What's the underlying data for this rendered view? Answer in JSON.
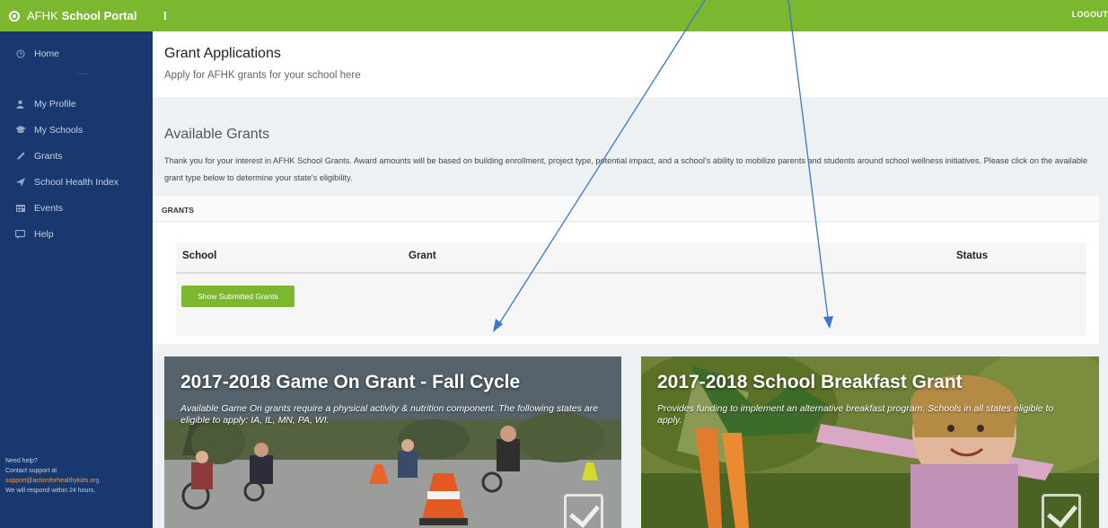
{
  "topbar": {
    "brand_prefix": "AFHK",
    "brand_name": "School Portal",
    "menu_toggle": "I",
    "logout_label": "LOGOUT",
    "accent_color": "#7cb82f"
  },
  "sidebar": {
    "background_color": "#1a3870",
    "items": [
      {
        "label": "Home",
        "icon": "clock-icon"
      },
      {
        "label": "My Profile",
        "icon": "user-icon"
      },
      {
        "label": "My Schools",
        "icon": "graduation-cap-icon"
      },
      {
        "label": "Grants",
        "icon": "pencil-icon"
      },
      {
        "label": "School Health Index",
        "icon": "send-icon"
      },
      {
        "label": "Events",
        "icon": "calendar-icon"
      },
      {
        "label": "Help",
        "icon": "chat-icon"
      }
    ],
    "help": {
      "line1": "Need help?",
      "line2": "Contact support at",
      "email": "support@actionforhealthykids.org.",
      "line4": "We will respond within 24 hours."
    }
  },
  "header": {
    "title": "Grant Applications",
    "subtitle": "Apply for AFHK grants for your school here"
  },
  "available": {
    "title": "Available Grants",
    "description": "Thank you for your interest in AFHK School Grants. Award amounts will be based on building enrollment, project type, potential impact, and a school's ability to mobilize parents and students around school wellness initiatives. Please click on the available grant type below to determine your state's eligibility."
  },
  "grants_panel": {
    "heading": "GRANTS",
    "columns": [
      "School",
      "Grant",
      "Status"
    ],
    "show_button": "Show Submitted Grants"
  },
  "cards": [
    {
      "title": "2017-2018 Game On Grant - Fall Cycle",
      "description": "Available Game On grants require a physical activity & nutrition component. The following states are eligible to apply: IA, IL, MN, PA, WI.",
      "icon": "check-square-icon"
    },
    {
      "title": "2017-2018 School Breakfast Grant",
      "description": "Provides funding to implement an alternative breakfast program. Schools in all states eligible to apply.",
      "icon": "check-square-icon"
    }
  ]
}
